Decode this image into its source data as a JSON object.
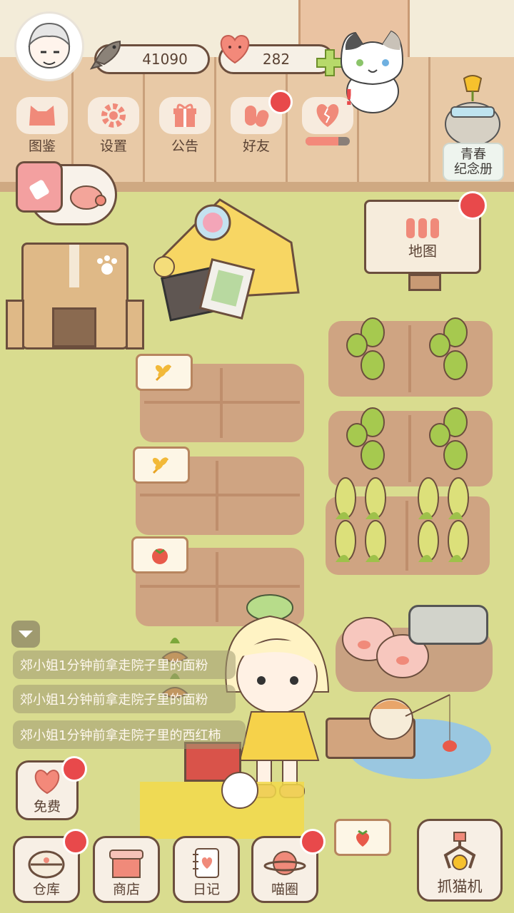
{
  "header": {
    "fish_count": "41090",
    "heart_count": "282"
  },
  "top_menu": [
    {
      "label": "图鉴",
      "icon": "cat-face-icon",
      "badge": false
    },
    {
      "label": "设置",
      "icon": "gear-icon",
      "badge": false
    },
    {
      "label": "公告",
      "icon": "gift-icon",
      "badge": false
    },
    {
      "label": "好友",
      "icon": "friends-icon",
      "badge": true
    },
    {
      "label": "",
      "icon": "heart-broken-icon",
      "badge": true
    }
  ],
  "album_button": {
    "label_line1": "青春",
    "label_line2": "纪念册"
  },
  "map_sign": {
    "label": "地图",
    "badge": true
  },
  "messages": [
    "郊小姐1分钟前拿走院子里的面粉",
    "郊小姐1分钟前拿走院子里的面粉",
    "郊小姐1分钟前拿走院子里的西红柿"
  ],
  "free_button": {
    "label": "免费",
    "badge": true
  },
  "bottom_nav": [
    {
      "label": "仓库",
      "icon": "warehouse-icon",
      "badge": true
    },
    {
      "label": "商店",
      "icon": "shop-icon",
      "badge": false
    },
    {
      "label": "日记",
      "icon": "diary-icon",
      "badge": false
    },
    {
      "label": "喵圈",
      "icon": "cat-planet-icon",
      "badge": true
    }
  ],
  "claw_machine": {
    "label": "抓猫机"
  },
  "colors": {
    "grass": "#d9dc8f",
    "soil": "#cfa482",
    "badge_red": "#e8494b",
    "outline_brown": "#6b4e3d",
    "coral": "#f08a7a"
  }
}
